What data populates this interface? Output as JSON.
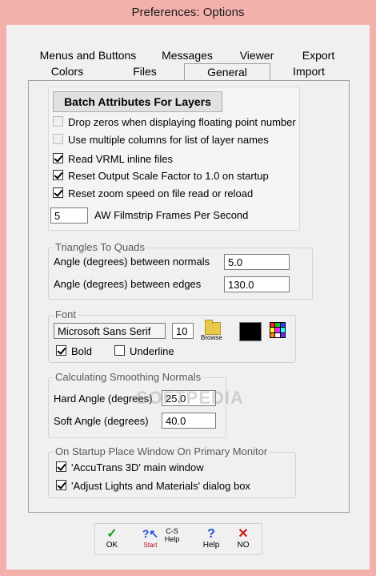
{
  "window": {
    "title": "Preferences: Options"
  },
  "tabs": {
    "row1": [
      "Menus and Buttons",
      "Messages",
      "Viewer",
      "Export"
    ],
    "row2": [
      "Colors",
      "Files",
      "General",
      "Import"
    ],
    "active": "General"
  },
  "general": {
    "batch_button": "Batch Attributes For Layers",
    "checkboxes": [
      {
        "label": "Drop zeros when displaying floating point number",
        "checked": false,
        "disabled": true
      },
      {
        "label": "Use multiple columns for list of layer names",
        "checked": false,
        "disabled": true
      },
      {
        "label": "Read VRML inline files",
        "checked": true
      },
      {
        "label": "Reset Output Scale Factor to 1.0 on startup",
        "checked": true
      },
      {
        "label": "Reset zoom speed on file read or reload",
        "checked": true
      }
    ],
    "filmstrip": {
      "value": "5",
      "label": "AW Filmstrip Frames Per Second"
    }
  },
  "triangles": {
    "legend": "Triangles To Quads",
    "normals_label": "Angle (degrees) between normals",
    "normals_value": "5.0",
    "edges_label": "Angle (degrees) between edges",
    "edges_value": "130.0"
  },
  "font": {
    "legend": "Font",
    "name": "Microsoft Sans Serif",
    "size": "10",
    "browse": "Browse",
    "bold_label": "Bold",
    "bold_checked": true,
    "underline_label": "Underline",
    "underline_checked": false,
    "color": "#000000"
  },
  "smoothing": {
    "legend": "Calculating Smoothing Normals",
    "hard_label": "Hard Angle (degrees)",
    "hard_value": "25.0",
    "soft_label": "Soft Angle (degrees)",
    "soft_value": "40.0"
  },
  "startup": {
    "legend": "On Startup Place Window On Primary Monitor",
    "main_label": "'AccuTrans 3D' main window",
    "main_checked": true,
    "dialog_label": "'Adjust Lights and Materials' dialog box",
    "dialog_checked": true
  },
  "bottom": {
    "ok": "OK",
    "cs_top": "C-S",
    "cs_bottom": "Help",
    "start": "Start",
    "help": "Help",
    "no": "NO"
  },
  "watermark": "SOFTPEDIA",
  "colors": {
    "title_bg": "#f4b1ab",
    "ok_green": "#1a9a1a",
    "help_blue": "#1a4fd6",
    "no_red": "#d01818"
  }
}
